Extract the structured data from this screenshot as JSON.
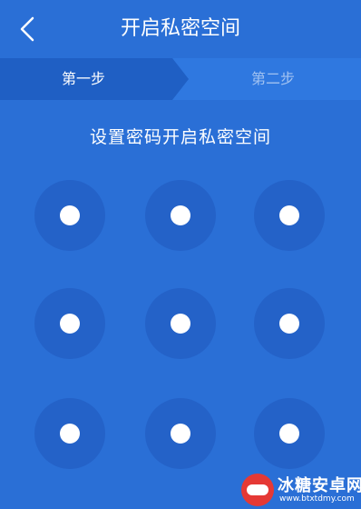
{
  "header": {
    "title": "开启私密空间",
    "back_icon": "chevron-left-icon"
  },
  "steps": {
    "step1": "第一步",
    "step2": "第二步"
  },
  "instruction": "设置密码开启私密空间",
  "pattern_grid": {
    "rows": 3,
    "cols": 3
  },
  "watermark": {
    "title": "冰糖安卓网",
    "url": "www.btxtdmy.com"
  },
  "colors": {
    "background": "#2a6fd6",
    "active_step": "#1f5fc4",
    "dot_ring": "#2462c8",
    "dot_center": "#ffffff"
  }
}
